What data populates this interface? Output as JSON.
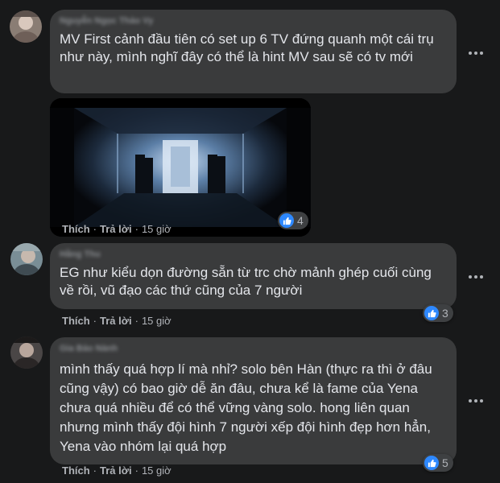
{
  "comments": [
    {
      "author": "Nguyễn Ngọc Thảo Vy",
      "text": "MV First cảnh đầu tiên có set up 6 TV đứng quanh một cái trụ như này, mình nghĩ đây có thể là hint MV sau sẽ có tv mới",
      "reactions": "4",
      "like": "Thích",
      "reply": "Trả lời",
      "time": "15 giờ"
    },
    {
      "author": "Hằng Thu",
      "text": "EG như kiểu dọn đường sẵn từ trc chờ mảnh ghép cuối cùng về rồi, vũ đạo các thứ cũng của 7 người",
      "reactions": "3",
      "like": "Thích",
      "reply": "Trả lời",
      "time": "15 giờ"
    },
    {
      "author": "Gia Bảo Nành",
      "text": "mình thấy quá hợp lí mà nhỉ? solo bên Hàn (thực ra thì ở đâu cũng vậy) có bao giờ dễ ăn đâu, chưa kể là fame của Yena chưa quá nhiều để có thể vững vàng solo. hong liên quan nhưng mình thấy đội hình 7 người xếp đội hình đẹp hơn hẳn, Yena vào nhóm lại quá hợp",
      "reactions": "5",
      "like": "Thích",
      "reply": "Trả lời",
      "time": "15 giờ"
    }
  ],
  "sep": "·",
  "colors": {
    "background": "#18191a",
    "bubble": "#3a3b3c",
    "text": "#e4e6eb",
    "muted": "#b0b3b8",
    "like_blue": "#2d88ff"
  },
  "icons": {
    "more": "more-options-icon",
    "like": "thumbs-up-icon"
  }
}
